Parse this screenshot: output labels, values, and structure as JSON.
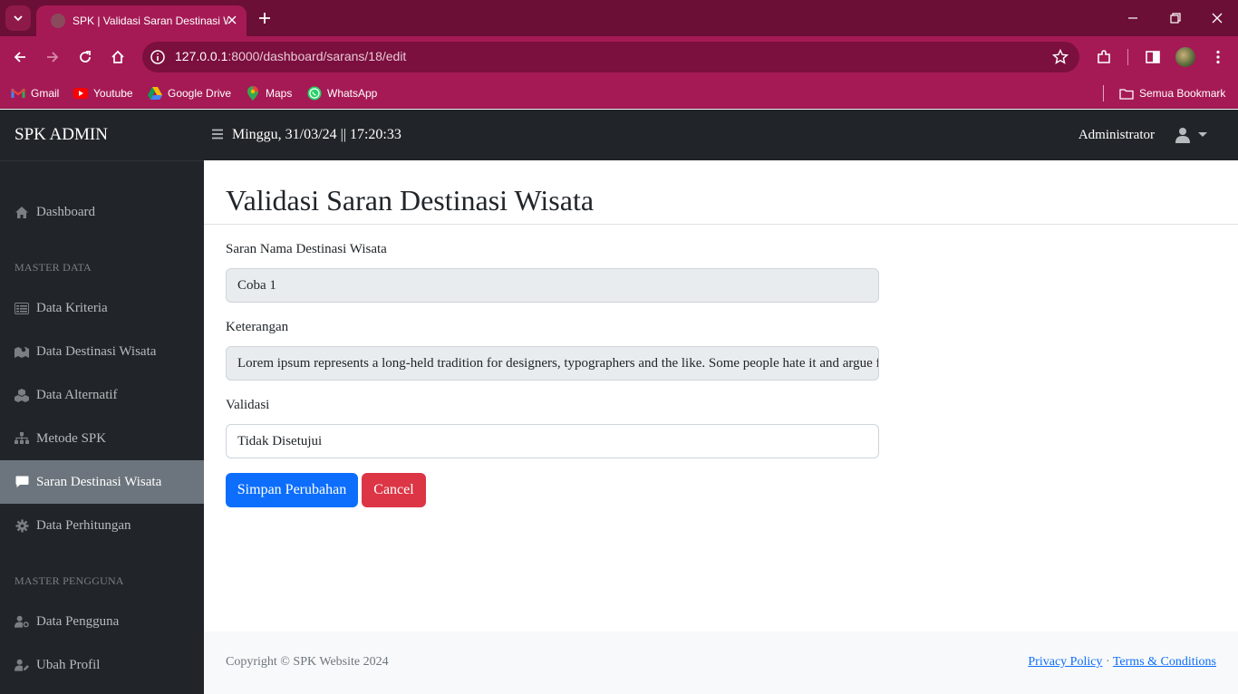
{
  "browser": {
    "tab_title": "SPK | Validasi Saran Destinasi Wisata",
    "url_host": "127.0.0.1",
    "url_rest": ":8000/dashboard/sarans/18/edit",
    "bookmarks": [
      "Gmail",
      "Youtube",
      "Google Drive",
      "Maps",
      "WhatsApp"
    ],
    "all_bookmarks": "Semua Bookmark"
  },
  "topnav": {
    "brand": "SPK ADMIN",
    "datetime": "Minggu, 31/03/24 || 17:20:33",
    "user": "Administrator"
  },
  "sidebar": {
    "dashboard": "Dashboard",
    "heading_master_data": "MASTER DATA",
    "items": [
      "Data Kriteria",
      "Data Destinasi Wisata",
      "Data Alternatif",
      "Metode SPK",
      "Saran Destinasi Wisata",
      "Data Perhitungan"
    ],
    "heading_master_pengguna": "MASTER PENGGUNA",
    "user_items": [
      "Data Pengguna",
      "Ubah Profil"
    ]
  },
  "page": {
    "title": "Validasi Saran Destinasi Wisata",
    "fields": {
      "nama_label": "Saran Nama Destinasi Wisata",
      "nama_value": "Coba 1",
      "keterangan_label": "Keterangan",
      "keterangan_value": "Lorem ipsum represents a long-held tradition for designers, typographers and the like. Some people hate it and argue for its demise",
      "validasi_label": "Validasi",
      "validasi_value": "Tidak Disetujui"
    },
    "buttons": {
      "save": "Simpan Perubahan",
      "cancel": "Cancel"
    }
  },
  "footer": {
    "copyright": "Copyright © SPK Website 2024",
    "privacy": "Privacy Policy",
    "separator": "·",
    "terms": "Terms & Conditions"
  },
  "colors": {
    "chrome_dark": "#6b0f36",
    "chrome": "#a51a55",
    "app_dark": "#212529",
    "primary": "#0d6efd",
    "danger": "#dc3545",
    "active_item": "#6c757d"
  }
}
